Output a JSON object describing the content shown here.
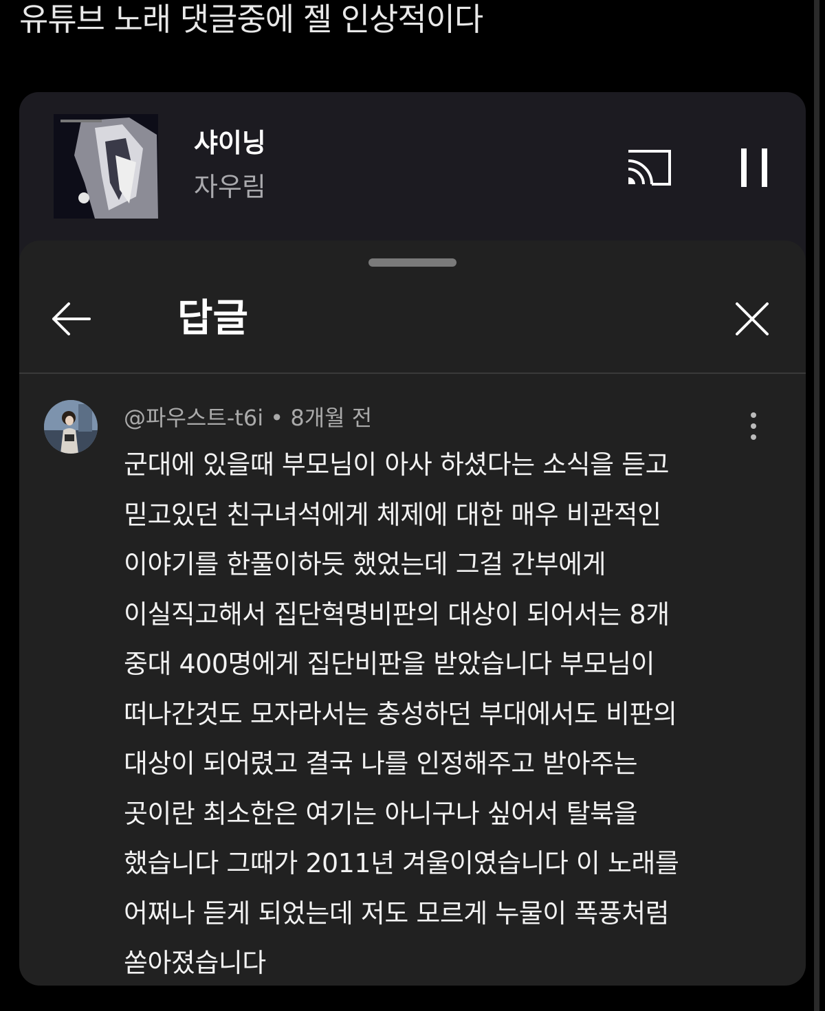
{
  "post": {
    "title": "유튜브 노래 댓글중에 젤 인상적이다"
  },
  "player": {
    "track_title": "샤이닝",
    "artist": "자우림",
    "icons": {
      "cast": "cast-icon",
      "pause": "pause-icon",
      "album": "album-art"
    }
  },
  "sheet": {
    "title": "답글",
    "icons": {
      "back": "arrow-left-icon",
      "close": "close-icon",
      "more": "more-vertical-icon"
    }
  },
  "comment": {
    "author": "@파우스트-t6i",
    "separator": "•",
    "time": "8개월 전",
    "lines": [
      "군대에 있을때 부모님이 아사 하셨다는 소식을 듣고",
      "믿고있던 친구녀석에게 체제에 대한 매우 비관적인",
      "이야기를 한풀이하듯 했었는데 그걸 간부에게",
      "이실직고해서 집단혁명비판의 대상이 되어서는 8개",
      "중대 400명에게 집단비판을 받았습니다 부모님이",
      "떠나간것도 모자라서는 충성하던 부대에서도 비판의",
      "대상이 되어렸고 결국 나를 인정해주고 받아주는",
      "곳이란 최소한은 여기는 아니구나 싶어서 탈북을",
      "했습니다 그때가 2011년 겨울이였습니다 이 노래를",
      "어쩌나 듣게 되었는데 저도 모르게 누물이 폭풍처럼",
      "쏟아졌습니다"
    ]
  },
  "colors": {
    "background": "#000000",
    "player_bg": "#1c1b21",
    "sheet_bg": "#212121",
    "muted_text": "#aaaaaa"
  }
}
